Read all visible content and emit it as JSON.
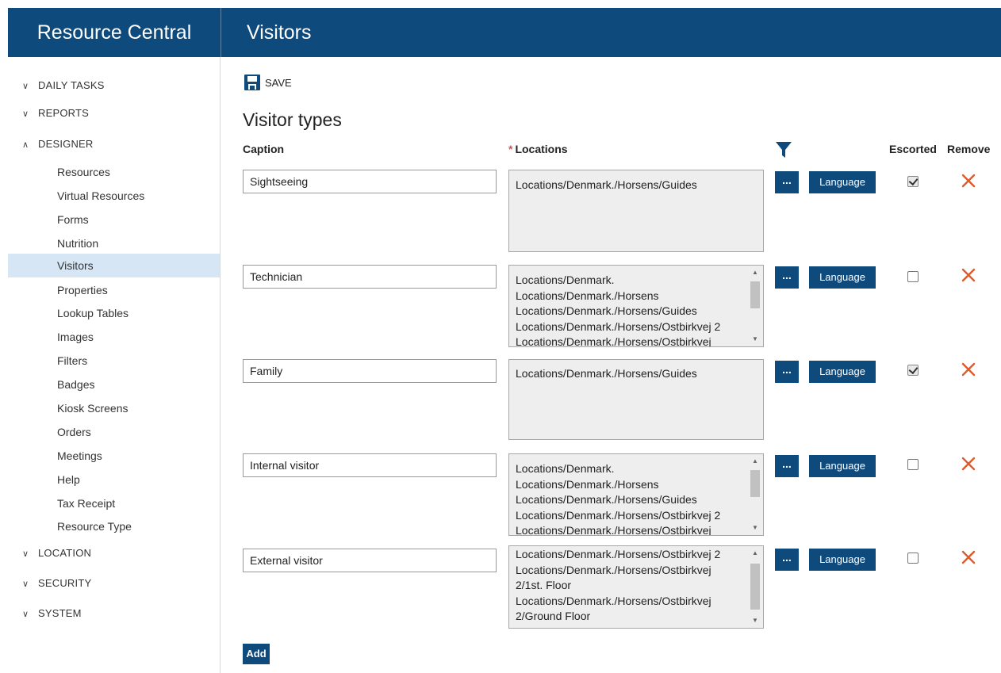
{
  "header": {
    "brand": "Resource Central",
    "page_title": "Visitors"
  },
  "sidebar": {
    "sections": [
      {
        "label": "DAILY TASKS",
        "expanded": false
      },
      {
        "label": "REPORTS",
        "expanded": false
      },
      {
        "label": "DESIGNER",
        "expanded": true
      },
      {
        "label": "LOCATION",
        "expanded": false
      },
      {
        "label": "SECURITY",
        "expanded": false
      },
      {
        "label": "SYSTEM",
        "expanded": false
      }
    ],
    "designer_items": [
      {
        "label": "Resources"
      },
      {
        "label": "Virtual Resources"
      },
      {
        "label": "Forms"
      },
      {
        "label": "Nutrition"
      },
      {
        "label": "Visitors",
        "active": true
      },
      {
        "label": "Properties"
      },
      {
        "label": "Lookup Tables"
      },
      {
        "label": "Images"
      },
      {
        "label": "Filters"
      },
      {
        "label": "Badges"
      },
      {
        "label": "Kiosk Screens"
      },
      {
        "label": "Orders"
      },
      {
        "label": "Meetings"
      },
      {
        "label": "Help"
      },
      {
        "label": "Tax Receipt"
      },
      {
        "label": "Resource Type"
      }
    ]
  },
  "toolbar": {
    "save_label": "SAVE"
  },
  "main": {
    "heading": "Visitor types",
    "columns": {
      "caption": "Caption",
      "locations": "Locations",
      "required_marker": "*",
      "escorted": "Escorted",
      "remove": "Remove"
    },
    "rows": [
      {
        "caption": "Sightseeing",
        "locations": [
          "Locations/Denmark./Horsens/Guides"
        ],
        "escorted": true,
        "more_label": "...",
        "language_label": "Language"
      },
      {
        "caption": "Technician",
        "locations": [
          "Locations/Denmark.",
          "Locations/Denmark./Horsens",
          "Locations/Denmark./Horsens/Guides",
          "Locations/Denmark./Horsens/Ostbirkvej 2",
          "Locations/Denmark./Horsens/Ostbirkvej"
        ],
        "escorted": false,
        "more_label": "...",
        "language_label": "Language"
      },
      {
        "caption": "Family",
        "locations": [
          "Locations/Denmark./Horsens/Guides"
        ],
        "escorted": true,
        "more_label": "...",
        "language_label": "Language"
      },
      {
        "caption": "Internal visitor",
        "locations": [
          "Locations/Denmark.",
          "Locations/Denmark./Horsens",
          "Locations/Denmark./Horsens/Guides",
          "Locations/Denmark./Horsens/Ostbirkvej 2",
          "Locations/Denmark./Horsens/Ostbirkvej"
        ],
        "escorted": false,
        "more_label": "...",
        "language_label": "Language"
      },
      {
        "caption": "External visitor",
        "locations": [
          "Locations/Denmark./Horsens/Ostbirkvej 2",
          "Locations/Denmark./Horsens/Ostbirkvej",
          "2/1st. Floor",
          "Locations/Denmark./Horsens/Ostbirkvej",
          "2/Ground Floor"
        ],
        "escorted": false,
        "more_label": "...",
        "language_label": "Language"
      }
    ],
    "add_label": "Add"
  },
  "colors": {
    "brand": "#0f4a7c",
    "active_nav": "#d6e6f4",
    "remove": "#e05a2b"
  }
}
